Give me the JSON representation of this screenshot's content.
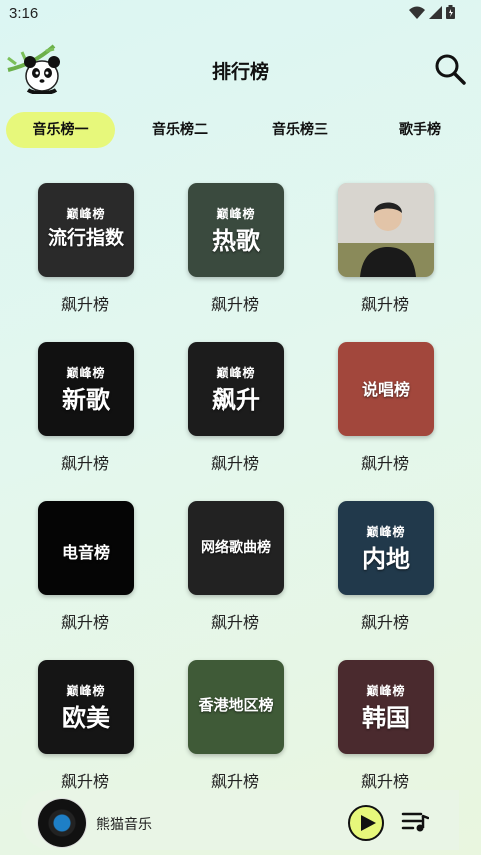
{
  "status": {
    "time": "3:16"
  },
  "header": {
    "title": "排行榜"
  },
  "tabs": [
    {
      "label": "音乐榜一",
      "active": true
    },
    {
      "label": "音乐榜二",
      "active": false
    },
    {
      "label": "音乐榜三",
      "active": false
    },
    {
      "label": "歌手榜",
      "active": false
    }
  ],
  "covers": [
    {
      "text": "流行指数",
      "brand": "巅峰榜",
      "label": "飙升榜",
      "bg": "#2a2a2a"
    },
    {
      "text": "热歌",
      "brand": "巅峰榜",
      "label": "飙升榜",
      "bg": "#3a4a3e"
    },
    {
      "text": "",
      "brand": "",
      "label": "飙升榜",
      "bg": "#c9c3b6"
    },
    {
      "text": "新歌",
      "brand": "巅峰榜",
      "label": "飙升榜",
      "bg": "#111111"
    },
    {
      "text": "飙升",
      "brand": "巅峰榜",
      "label": "飙升榜",
      "bg": "#1c1c1c"
    },
    {
      "text": "说唱榜",
      "brand": "",
      "label": "飙升榜",
      "bg": "#a2473c"
    },
    {
      "text": "电音榜",
      "brand": "",
      "label": "飙升榜",
      "bg": "#050505"
    },
    {
      "text": "网络歌曲榜",
      "brand": "",
      "label": "飙升榜",
      "bg": "#222222"
    },
    {
      "text": "内地",
      "brand": "巅峰榜",
      "label": "飙升榜",
      "bg": "#21394b"
    },
    {
      "text": "欧美",
      "brand": "巅峰榜",
      "label": "飙升榜",
      "bg": "#151515"
    },
    {
      "text": "香港地区榜",
      "brand": "",
      "label": "飙升榜",
      "bg": "#3f5a37"
    },
    {
      "text": "韩国",
      "brand": "巅峰榜",
      "label": "飙升榜",
      "bg": "#4a2a2e"
    }
  ],
  "player": {
    "name": "熊猫音乐"
  },
  "colors": {
    "accent": "#e7f87b"
  }
}
